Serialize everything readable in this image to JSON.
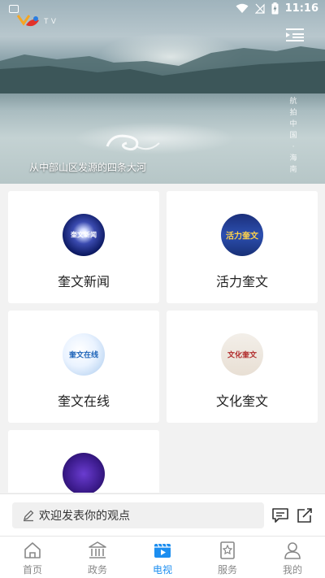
{
  "status_bar": {
    "time": "11:16"
  },
  "hero": {
    "logo_text": "T  V",
    "caption": "从中部山区发源的四条大河",
    "vertical_text": [
      "航",
      "拍",
      "中",
      "国",
      "·",
      "海",
      "南"
    ]
  },
  "channels": [
    {
      "label": "奎文新闻",
      "icon_name": "kuiwen-news-logo",
      "icon_text": "奎文新闻"
    },
    {
      "label": "活力奎文",
      "icon_name": "vital-kuiwen-logo",
      "icon_text": "活力奎文"
    },
    {
      "label": "奎文在线",
      "icon_name": "kuiwen-online-logo",
      "icon_text": "奎文在线"
    },
    {
      "label": "文化奎文",
      "icon_name": "culture-kuiwen-logo",
      "icon_text": "文化奎文"
    },
    {
      "label": "",
      "icon_name": "fifth-channel-logo",
      "icon_text": ""
    }
  ],
  "comment_bar": {
    "placeholder": "欢迎发表你的观点"
  },
  "bottom_nav": [
    {
      "label": "首页",
      "icon": "home-icon",
      "active": false
    },
    {
      "label": "政务",
      "icon": "government-icon",
      "active": false
    },
    {
      "label": "电视",
      "icon": "tv-icon",
      "active": true
    },
    {
      "label": "服务",
      "icon": "service-icon",
      "active": false
    },
    {
      "label": "我的",
      "icon": "profile-icon",
      "active": false
    }
  ],
  "colors": {
    "accent": "#1c8ef0",
    "inactive": "#888888",
    "background": "#f2f2f2"
  }
}
